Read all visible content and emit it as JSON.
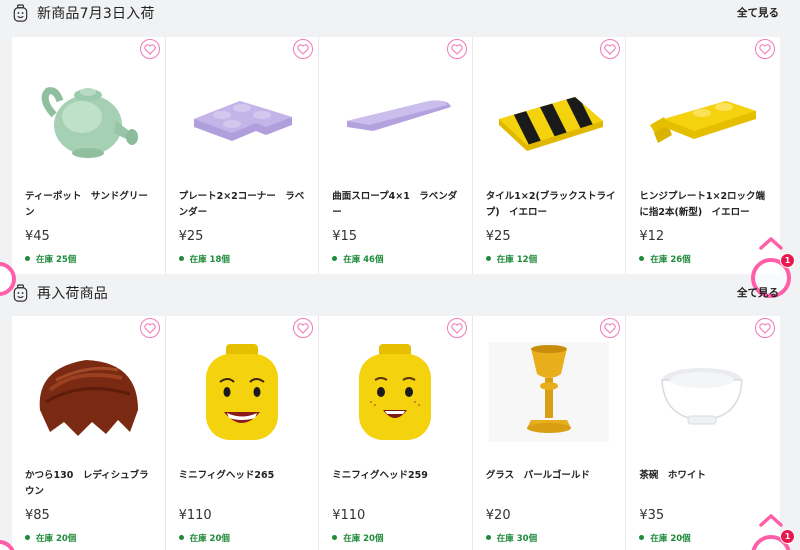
{
  "sections": [
    {
      "title": "新商品7月3日入荷",
      "see_all": "全て見る",
      "products": [
        {
          "name": "ティーポット　サンドグリーン",
          "price": "¥45",
          "stock": "在庫 25個",
          "image": "teapot-sand-green"
        },
        {
          "name": "プレート2×2コーナー　ラベンダー",
          "price": "¥25",
          "stock": "在庫 18個",
          "image": "corner-plate-lavender"
        },
        {
          "name": "曲面スロープ4×1　ラベンダー",
          "price": "¥15",
          "stock": "在庫 46個",
          "image": "curved-slope-lavender"
        },
        {
          "name": "タイル1×2(ブラックストライプ)　イエロー",
          "price": "¥25",
          "stock": "在庫 12個",
          "image": "striped-tile-yellow"
        },
        {
          "name": "ヒンジプレート1×2ロック端に指2本(新型)　イエロー",
          "price": "¥12",
          "stock": "在庫 26個",
          "image": "hinge-plate-yellow"
        }
      ]
    },
    {
      "title": "再入荷商品",
      "see_all": "全て見る",
      "products": [
        {
          "name": "かつら130　レディシュブラウン",
          "price": "¥85",
          "stock": "在庫 20個",
          "image": "wig-reddish-brown"
        },
        {
          "name": "ミニフィグヘッド265",
          "price": "¥110",
          "stock": "在庫 20個",
          "image": "minifig-head-265"
        },
        {
          "name": "ミニフィグヘッド259",
          "price": "¥110",
          "stock": "在庫 20個",
          "image": "minifig-head-259"
        },
        {
          "name": "グラス　パールゴールド",
          "price": "¥20",
          "stock": "在庫 30個",
          "image": "goblet-pearl-gold"
        },
        {
          "name": "茶碗　ホワイト",
          "price": "¥35",
          "stock": "在庫 20個",
          "image": "bowl-white"
        }
      ]
    }
  ],
  "cart_badge": "1",
  "colors": {
    "accent_pink": "#ff5fa8",
    "heart_pink": "#f07ab9",
    "stock_green": "#1f8a3a",
    "badge_red": "#e8174d",
    "sand_green": "#a5d0b4",
    "lavender": "#c5b4e8",
    "yellow": "#f5d20e",
    "reddish_brown": "#7a2a12",
    "pearl_gold": "#e8ae1c",
    "white": "#ffffff"
  },
  "icons": {
    "section": "minifig-face-icon",
    "favorite": "heart-outline-icon",
    "scroll_top": "chevron-up-icon",
    "cart": "cart-ring-icon"
  }
}
